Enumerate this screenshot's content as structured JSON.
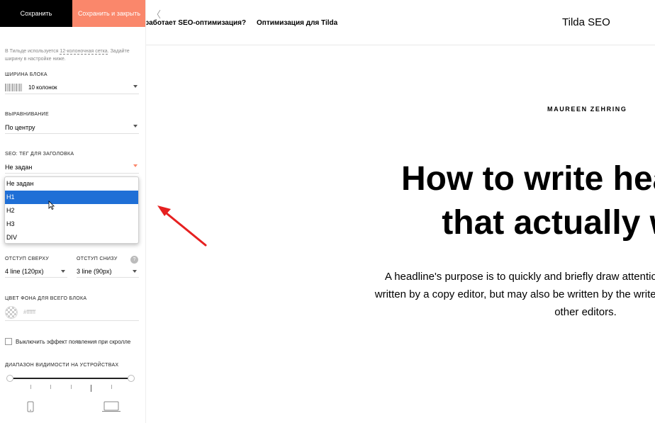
{
  "toolbar": {
    "save_label": "Сохранить",
    "save_close_label": "Сохранить и закрыть"
  },
  "settings": {
    "hint_pre": "В Тильде используется ",
    "hint_link": "12-колоночная сетка",
    "hint_post": ". Задайте ширину в настройке ниже.",
    "width_label": "ШИРИНА БЛОКА",
    "width_value": "10 колонок",
    "align_label": "ВЫРАВНИВАНИЕ",
    "align_value": "По центру",
    "seo_label": "SEO: ТЕГ ДЛЯ ЗАГОЛОВКА",
    "seo_value": "Не задан",
    "seo_options": [
      "Не задан",
      "H1",
      "H2",
      "H3",
      "DIV"
    ],
    "seo_selected": "H1",
    "pad_top_label": "ОТСТУП СВЕРХУ",
    "pad_top_value": "4 line (120px)",
    "pad_bottom_label": "ОТСТУП СНИЗУ",
    "pad_bottom_value": "3 line (90px)",
    "help_glyph": "?",
    "bg_label": "ЦВЕТ ФОНА ДЛЯ ВСЕГО БЛОКА",
    "bg_value": "#ffffff",
    "scroll_effect_label": "Выключить эффект появления при скролле",
    "visibility_label": "ДИАПАЗОН ВИДИМОСТИ НА УСТРОЙСТВАХ"
  },
  "preview": {
    "back_glyph": "〈",
    "menu": [
      "работает SEO-оптимизация?",
      "Оптимизация для Tilda"
    ],
    "brand": "Tilda SEO",
    "author": "MAUREEN ZEHRING",
    "headline_1": "How to write headlines",
    "headline_2": "that actually work",
    "lead_1": "A headline's purpose is to quickly and briefly draw attention to the story. It is generally",
    "lead_2": "written by a copy editor, but may also be written by the writer, the page layout designer, or",
    "lead_3": "other editors."
  },
  "colors": {
    "accent": "#fa876b",
    "selection": "#1f6fd6",
    "annotation_arrow": "#e62020"
  }
}
